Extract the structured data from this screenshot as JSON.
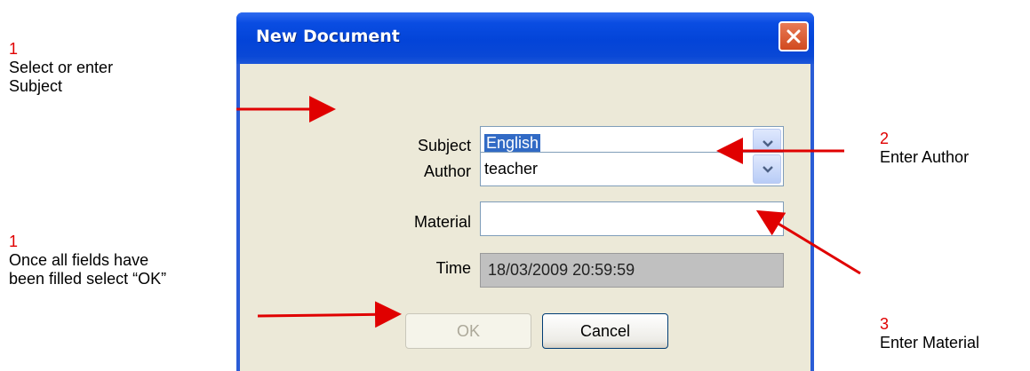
{
  "annotations": [
    {
      "num": "1",
      "text_lines": [
        "Select or enter",
        "Subject"
      ]
    },
    {
      "num": "1",
      "text_lines": [
        "Once all fields have",
        "been filled select “OK”"
      ]
    },
    {
      "num": "2",
      "text_lines": [
        "Enter Author"
      ]
    },
    {
      "num": "3",
      "text_lines": [
        "Enter Material"
      ]
    }
  ],
  "dialog": {
    "title": "New Document",
    "fields": {
      "subject": {
        "label": "Subject",
        "value": "English"
      },
      "author": {
        "label": "Author",
        "value": "teacher"
      },
      "material": {
        "label": "Material",
        "value": ""
      },
      "time": {
        "label": "Time",
        "value": "18/03/2009 20:59:59"
      }
    },
    "buttons": {
      "ok": "OK",
      "cancel": "Cancel"
    }
  },
  "colors": {
    "annotation_number": "#e00000",
    "arrow": "#e00000",
    "titlebar": "#0344d8",
    "client_bg": "#ece9d8",
    "selection": "#316ac5"
  },
  "icons": {
    "close": "close-icon",
    "dropdown": "chevron-down-icon"
  }
}
